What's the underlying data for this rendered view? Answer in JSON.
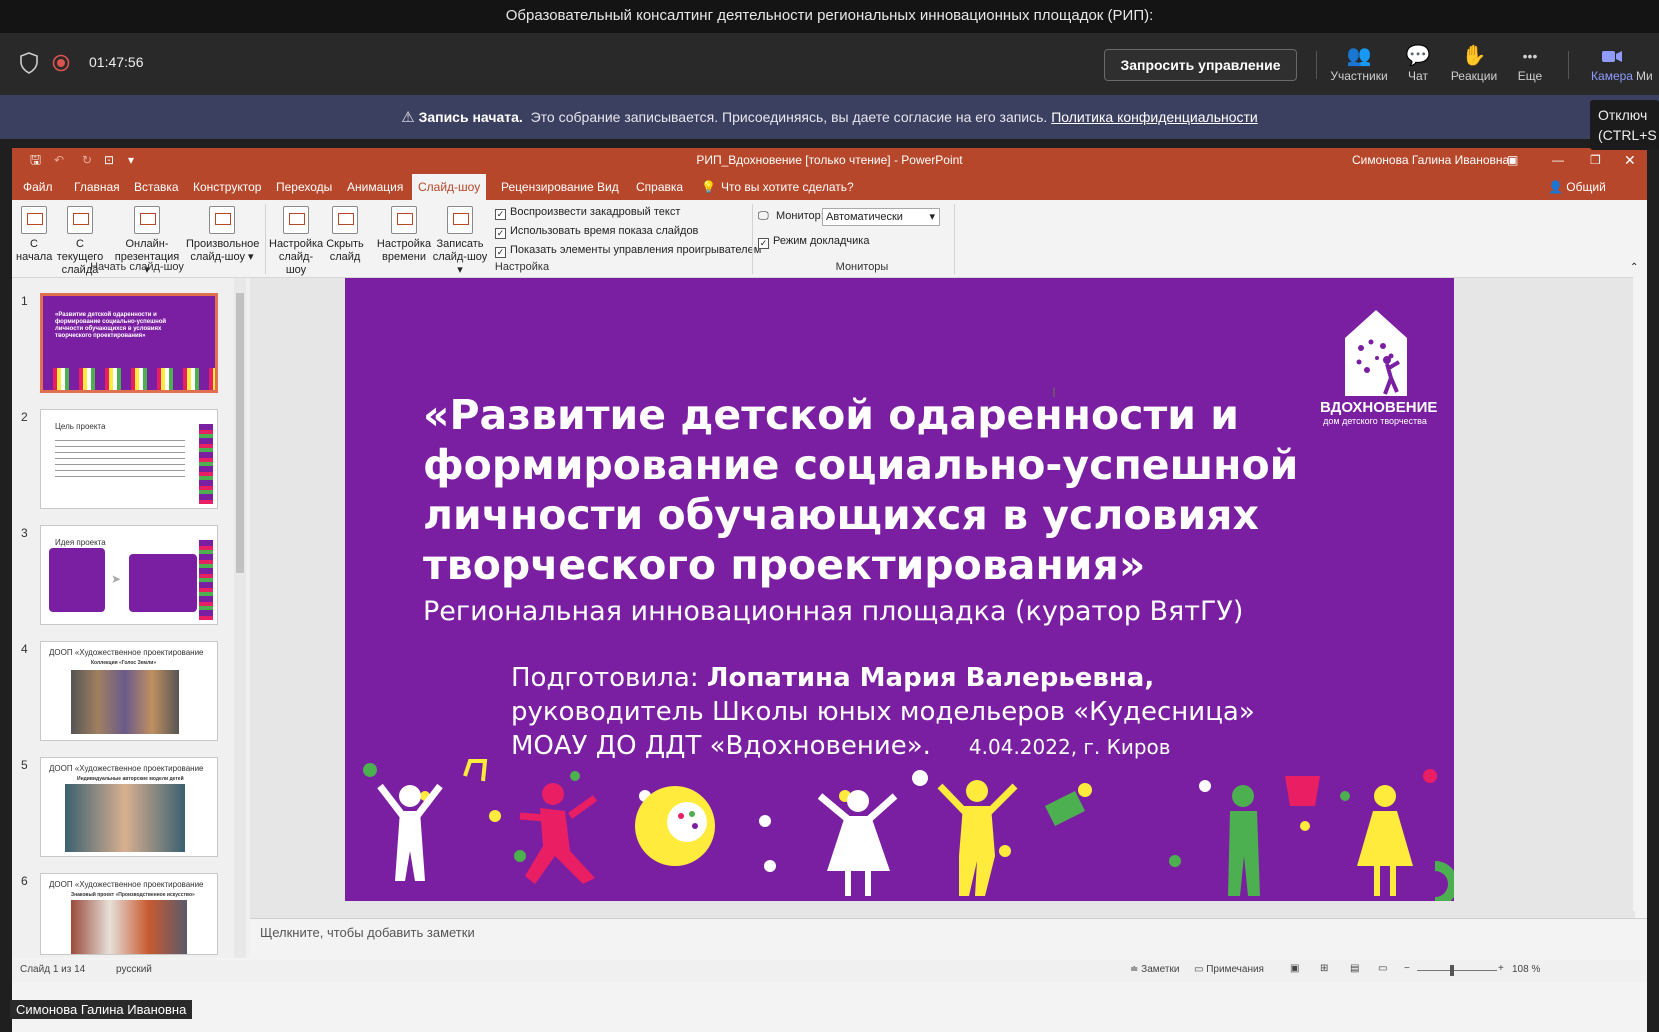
{
  "teams": {
    "meeting_title": "Образовательный консалтинг деятельности региональных инновационных площадок (РИП):",
    "timer": "01:47:56",
    "request_control": "Запросить управление",
    "tools": [
      {
        "label": "Участники",
        "icon": "participants-icon",
        "glyph": "👥"
      },
      {
        "label": "Чат",
        "icon": "chat-icon",
        "glyph": "💬"
      },
      {
        "label": "Реакции",
        "icon": "reactions-icon",
        "glyph": "✋"
      },
      {
        "label": "Еще",
        "icon": "more-icon",
        "glyph": "•••"
      },
      {
        "label": "Камера",
        "icon": "camera-icon",
        "glyph": "▰"
      },
      {
        "label": "Ми",
        "icon": "mic-icon",
        "glyph": ""
      }
    ],
    "tooltip_line1": "Отключ",
    "tooltip_line2": "(CTRL+S",
    "presenter": "Симонова Галина Ивановна"
  },
  "banner": {
    "bold": "Запись начата.",
    "text": "Это собрание записывается. Присоединяясь, вы даете согласие на его запись.",
    "link": "Политика конфиденциальности"
  },
  "ppt": {
    "window_title": "РИП_Вдохновение [только чтение]  -  PowerPoint",
    "user": "Симонова Галина Ивановна",
    "tabs": [
      "Файл",
      "Главная",
      "Вставка",
      "Конструктор",
      "Переходы",
      "Анимация",
      "Слайд-шоу",
      "Рецензирование",
      "Вид",
      "Справка"
    ],
    "search": "Что вы хотите сделать?",
    "share": "Общий доступ",
    "ribbon": {
      "btn_from_start": [
        "С",
        "начала"
      ],
      "btn_from_current": [
        "С текущего",
        "слайда"
      ],
      "btn_online": [
        "Онлайн-",
        "презентация ▾"
      ],
      "btn_custom": [
        "Произвольное",
        "слайд-шоу ▾"
      ],
      "group_start": "Начать слайд-шоу",
      "btn_setup": [
        "Настройка",
        "слайд-шоу"
      ],
      "btn_hide": [
        "Скрыть",
        "слайд"
      ],
      "btn_timing": [
        "Настройка",
        "времени"
      ],
      "btn_record": [
        "Записать",
        "слайд-шоу ▾"
      ],
      "chk_narration": "Воспроизвести закадровый текст",
      "chk_timings": "Использовать время показа слайдов",
      "chk_controls": "Показать элементы управления проигрывателем",
      "group_setup": "Настройка",
      "monitor_label": "Монитор:",
      "monitor_value": "Автоматически",
      "presenter_view": "Режим докладчика",
      "group_monitors": "Мониторы"
    },
    "thumbs": [
      {
        "num": "1",
        "title": "«Развитие детской одаренности и формирование социально-успешной личности обучающихся в условиях творческого проектирования»"
      },
      {
        "num": "2",
        "title": "Цель проекта"
      },
      {
        "num": "3",
        "title": "Идея проекта"
      },
      {
        "num": "4",
        "title": "ДООП «Художественное проектирование",
        "sub": "Коллекция «Голос Земли»"
      },
      {
        "num": "5",
        "title": "ДООП «Художественное проектирование",
        "sub": "Индивидуальные авторские модели детей"
      },
      {
        "num": "6",
        "title": "ДООП «Художественное проектирование",
        "sub": "Знаковый проект «Производственное искусство»"
      }
    ],
    "slide": {
      "title_l1": "«Развитие детской одаренности и",
      "title_l2": "формирование социально-успешной",
      "title_l3": "личности обучающихся в условиях",
      "title_l4": "творческого проектирования»",
      "subtitle": "Региональная инновационная площадка (куратор ВятГУ)",
      "prepared_label": "Подготовила:",
      "prepared_name": "Лопатина Мария Валерьевна,",
      "position": "руководитель Школы юных модельеров «Кудесница»",
      "org": "МОАУ ДО ДДТ «Вдохновение».",
      "date": "4.04.2022, г. Киров",
      "logo_name": "ВДОХНОВЕНИЕ",
      "logo_sub": "дом детского творчества"
    },
    "notes_placeholder": "Щелкните, чтобы добавить заметки",
    "status": {
      "slide_of": "Слайд 1 из 14",
      "lang": "русский",
      "notes": "Заметки",
      "comments": "Примечания",
      "zoom": "108 %"
    }
  },
  "colors": {
    "ppt_accent": "#b7472a",
    "slide_bg": "#7b1fa2",
    "banner_bg": "#3c4060"
  }
}
